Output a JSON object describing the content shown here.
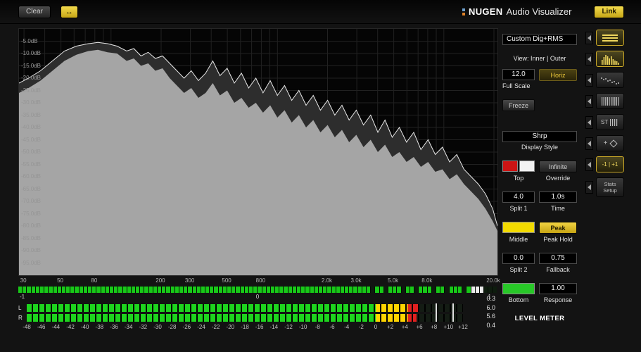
{
  "titlebar": {
    "clear_label": "Clear",
    "arrows_label": "↔",
    "brand_nugen": "NUGEN",
    "brand_product": "Audio Visualizer",
    "link_label": "Link"
  },
  "colors": {
    "accent_yellow": "#e8c832",
    "meter_green": "#1ed41e",
    "meter_yellow": "#ffd400",
    "meter_red": "#e02020",
    "spectrum_fill": "#a5a5a5",
    "peak_line": "#e8e8e8"
  },
  "spectrum": {
    "fmin": 28,
    "fmax": 21000,
    "db_min": -100,
    "db_max": 0,
    "db_labels": [
      "-5.0dB",
      "-10.0dB",
      "-15.0dB",
      "-20.0dB",
      "-25.0dB",
      "-30.0dB",
      "-35.0dB",
      "-40.0dB",
      "-45.0dB",
      "-50.0dB",
      "-55.0dB",
      "-60.0dB",
      "-65.0dB",
      "-70.0dB",
      "-75.0dB",
      "-80.0dB",
      "-85.0dB",
      "-90.0dB",
      "-95.0dB"
    ],
    "freq_ticks": [
      {
        "label": "30",
        "f": 30
      },
      {
        "label": "50",
        "f": 50
      },
      {
        "label": "80",
        "f": 80
      },
      {
        "label": "200",
        "f": 200
      },
      {
        "label": "300",
        "f": 300
      },
      {
        "label": "500",
        "f": 500
      },
      {
        "label": "800",
        "f": 800
      },
      {
        "label": "2.0k",
        "f": 2000
      },
      {
        "label": "3.0k",
        "f": 3000
      },
      {
        "label": "5.0k",
        "f": 5000
      },
      {
        "label": "8.0k",
        "f": 8000
      },
      {
        "label": "20.0k",
        "f": 20000
      }
    ],
    "grid_freqs": [
      30,
      40,
      50,
      60,
      70,
      80,
      90,
      100,
      200,
      300,
      400,
      500,
      600,
      700,
      800,
      900,
      1000,
      2000,
      3000,
      4000,
      5000,
      6000,
      7000,
      8000,
      9000,
      10000,
      20000
    ],
    "rms_points": [
      [
        0.0,
        -26
      ],
      [
        0.02,
        -24
      ],
      [
        0.045,
        -21
      ],
      [
        0.07,
        -17
      ],
      [
        0.095,
        -13
      ],
      [
        0.12,
        -10.5
      ],
      [
        0.145,
        -9
      ],
      [
        0.165,
        -8.5
      ],
      [
        0.185,
        -9.5
      ],
      [
        0.205,
        -10
      ],
      [
        0.225,
        -13
      ],
      [
        0.24,
        -12
      ],
      [
        0.255,
        -15
      ],
      [
        0.27,
        -14
      ],
      [
        0.285,
        -17
      ],
      [
        0.3,
        -16
      ],
      [
        0.315,
        -20
      ],
      [
        0.33,
        -23
      ],
      [
        0.345,
        -26
      ],
      [
        0.36,
        -24
      ],
      [
        0.375,
        -28
      ],
      [
        0.39,
        -26
      ],
      [
        0.405,
        -22
      ],
      [
        0.42,
        -27
      ],
      [
        0.435,
        -25
      ],
      [
        0.45,
        -30
      ],
      [
        0.465,
        -28
      ],
      [
        0.48,
        -32
      ],
      [
        0.495,
        -30
      ],
      [
        0.51,
        -34
      ],
      [
        0.525,
        -31
      ],
      [
        0.54,
        -36
      ],
      [
        0.555,
        -33
      ],
      [
        0.57,
        -38
      ],
      [
        0.585,
        -35
      ],
      [
        0.6,
        -40
      ],
      [
        0.615,
        -37
      ],
      [
        0.63,
        -42
      ],
      [
        0.645,
        -39
      ],
      [
        0.66,
        -44
      ],
      [
        0.675,
        -41
      ],
      [
        0.69,
        -46
      ],
      [
        0.705,
        -43
      ],
      [
        0.72,
        -48
      ],
      [
        0.735,
        -45
      ],
      [
        0.75,
        -50
      ],
      [
        0.765,
        -47
      ],
      [
        0.78,
        -52
      ],
      [
        0.795,
        -50
      ],
      [
        0.81,
        -54
      ],
      [
        0.825,
        -52
      ],
      [
        0.84,
        -56
      ],
      [
        0.855,
        -54
      ],
      [
        0.87,
        -58
      ],
      [
        0.885,
        -57
      ],
      [
        0.9,
        -61
      ],
      [
        0.915,
        -59
      ],
      [
        0.93,
        -63
      ],
      [
        0.945,
        -66
      ],
      [
        0.96,
        -69
      ],
      [
        0.975,
        -73
      ],
      [
        0.99,
        -78
      ],
      [
        1.0,
        -82
      ]
    ],
    "peak_points": [
      [
        0.0,
        -22
      ],
      [
        0.02,
        -20
      ],
      [
        0.045,
        -17
      ],
      [
        0.07,
        -13
      ],
      [
        0.095,
        -9
      ],
      [
        0.12,
        -7
      ],
      [
        0.145,
        -6
      ],
      [
        0.165,
        -5.5
      ],
      [
        0.185,
        -6
      ],
      [
        0.205,
        -7
      ],
      [
        0.225,
        -9
      ],
      [
        0.24,
        -8
      ],
      [
        0.255,
        -11
      ],
      [
        0.27,
        -9.5
      ],
      [
        0.285,
        -12
      ],
      [
        0.3,
        -11
      ],
      [
        0.315,
        -14
      ],
      [
        0.33,
        -17
      ],
      [
        0.345,
        -20
      ],
      [
        0.36,
        -17
      ],
      [
        0.375,
        -21
      ],
      [
        0.39,
        -18
      ],
      [
        0.405,
        -13
      ],
      [
        0.42,
        -19
      ],
      [
        0.435,
        -16
      ],
      [
        0.45,
        -22
      ],
      [
        0.465,
        -18
      ],
      [
        0.48,
        -24
      ],
      [
        0.495,
        -20
      ],
      [
        0.51,
        -26
      ],
      [
        0.525,
        -21
      ],
      [
        0.54,
        -27
      ],
      [
        0.555,
        -23
      ],
      [
        0.57,
        -29
      ],
      [
        0.585,
        -25
      ],
      [
        0.6,
        -31
      ],
      [
        0.615,
        -27
      ],
      [
        0.63,
        -33
      ],
      [
        0.645,
        -29
      ],
      [
        0.66,
        -35
      ],
      [
        0.675,
        -31
      ],
      [
        0.69,
        -37
      ],
      [
        0.705,
        -33
      ],
      [
        0.72,
        -39
      ],
      [
        0.735,
        -35
      ],
      [
        0.75,
        -42
      ],
      [
        0.765,
        -37
      ],
      [
        0.78,
        -44
      ],
      [
        0.795,
        -40
      ],
      [
        0.81,
        -46
      ],
      [
        0.825,
        -42
      ],
      [
        0.84,
        -49
      ],
      [
        0.855,
        -45
      ],
      [
        0.87,
        -51
      ],
      [
        0.885,
        -48
      ],
      [
        0.9,
        -54
      ],
      [
        0.915,
        -51
      ],
      [
        0.93,
        -57
      ],
      [
        0.945,
        -60
      ],
      [
        0.96,
        -63
      ],
      [
        0.975,
        -67
      ],
      [
        0.99,
        -73
      ],
      [
        1.0,
        -80
      ]
    ]
  },
  "correlation": {
    "segments": 110,
    "solid_to": 0.72,
    "sparse_to": 0.945,
    "white_from": 0.945,
    "white_to": 0.965,
    "left_label": "-1",
    "center_label": "0",
    "right_label": "1"
  },
  "meters": {
    "left_channel": "L",
    "right_channel": "R",
    "scale_min_db": -48,
    "scale_max_db": 12,
    "scale_labels": [
      "-48",
      "-46",
      "-44",
      "-42",
      "-40",
      "-38",
      "-36",
      "-34",
      "-32",
      "-30",
      "-28",
      "-26",
      "-24",
      "-22",
      "-20",
      "-18",
      "-16",
      "-14",
      "-12",
      "-10",
      "-8",
      "-6",
      "-4",
      "-2",
      "0",
      "+2",
      "+4",
      "+6",
      "+8",
      "+10",
      "+12"
    ],
    "channels": [
      {
        "name": "L",
        "green_to_db": 0,
        "yellow_to_db": 4.4,
        "peak_db": 6.0
      },
      {
        "name": "R",
        "green_to_db": 0,
        "yellow_to_db": 4.4,
        "peak_db": 5.6
      }
    ],
    "hold_marks_db": [
      8.2,
      10.5
    ],
    "readouts": [
      "0.3",
      "6.0",
      "5.6",
      "0.4"
    ]
  },
  "panel": {
    "preset": "Custom Dig+RMS",
    "view_label": "View: Inner | Outer",
    "full_scale_value": "12.0",
    "horiz_label": "Horiz",
    "full_scale_label": "Full Scale",
    "freeze_label": "Freeze",
    "display_style_value": "Shrp",
    "display_style_label": "Display Style",
    "infinite_label": "Infinite",
    "top_label": "Top",
    "override_label": "Override",
    "split1_value": "4.0",
    "time_value": "1.0s",
    "split1_label": "Split 1",
    "time_label": "Time",
    "peak_label": "Peak",
    "middle_label": "Middle",
    "peak_hold_label": "Peak Hold",
    "split2_value": "0.0",
    "fallback_value": "0.75",
    "split2_label": "Split 2",
    "fallback_label": "Fallback",
    "response_value": "1.00",
    "bottom_label": "Bottom",
    "response_label": "Response",
    "level_meter_label": "LEVEL METER"
  },
  "sidebar": {
    "st_label": "ST",
    "corr_label": "-1 | +1",
    "stats_line1": "Stats",
    "stats_line2": "Setup"
  }
}
